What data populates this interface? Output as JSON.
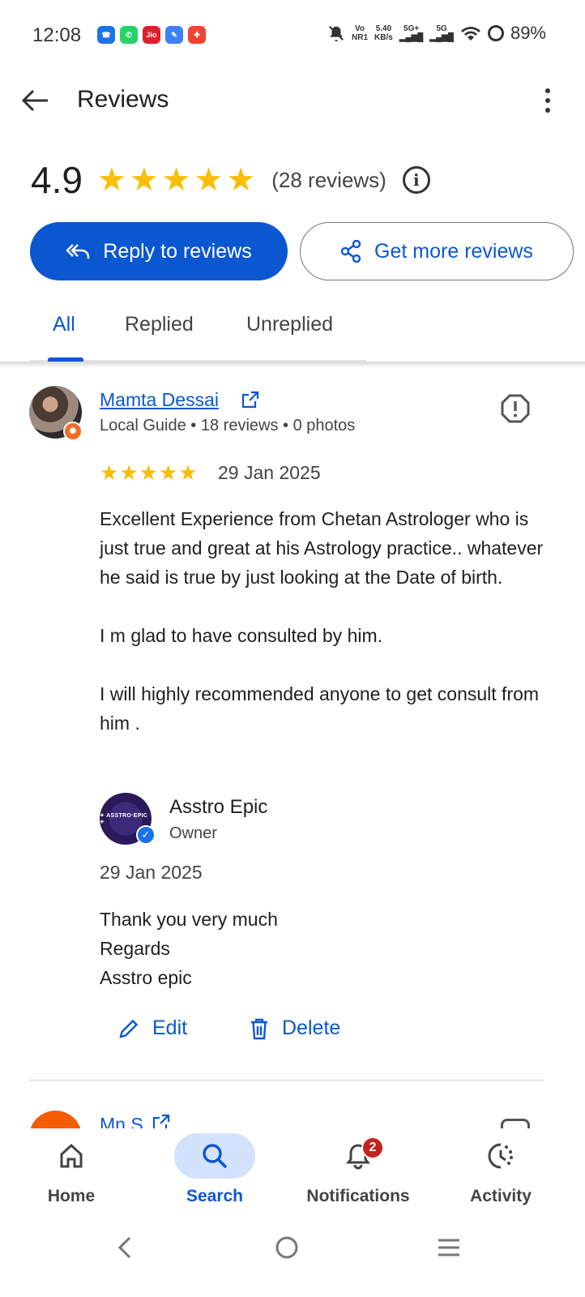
{
  "status_bar": {
    "time": "12:08",
    "network_line1": "Vo",
    "network_line2": "NR1",
    "speed_value": "5.40",
    "speed_unit": "KB/s",
    "sim1": "5G+",
    "sim2": "5G",
    "battery": "89%",
    "app_icons": [
      {
        "name": "phone-app-icon",
        "color": "#1a73e8",
        "label": "☎"
      },
      {
        "name": "whatsapp-icon",
        "color": "#25d366",
        "label": "✆"
      },
      {
        "name": "jio-icon",
        "color": "#e01e2b",
        "label": "Jio"
      },
      {
        "name": "chat-app-icon",
        "color": "#3b82f6",
        "label": "✎"
      },
      {
        "name": "gift-app-icon",
        "color": "#f44336",
        "label": "✚"
      }
    ]
  },
  "app_bar": {
    "title": "Reviews"
  },
  "summary": {
    "rating": "4.9",
    "star_count": 5,
    "review_count": "(28 reviews)"
  },
  "actions": {
    "reply_label": "Reply to reviews",
    "more_reviews_label": "Get more reviews"
  },
  "tabs": [
    {
      "label": "All",
      "active": true
    },
    {
      "label": "Replied",
      "active": false
    },
    {
      "label": "Unreplied",
      "active": false
    }
  ],
  "reviews": [
    {
      "name": "Mamta Dessai",
      "meta": "Local Guide • 18 reviews • 0 photos",
      "stars": 5,
      "date": "29 Jan 2025",
      "text": [
        "Excellent Experience from Chetan Astrologer who is just true and great at his Astrology practice.. whatever he said is true by just looking at the Date of birth.",
        "I m glad to have consulted by him.",
        "I will highly recommended anyone to get consult from him ."
      ],
      "reply": {
        "owner_name": "Asstro Epic",
        "owner_role": "Owner",
        "avatar_text": "✦ ASSTRO·EPIC ✦",
        "date": "29 Jan 2025",
        "lines": [
          "Thank you very much",
          "Regards",
          "Asstro epic"
        ]
      },
      "edit_label": "Edit",
      "delete_label": "Delete"
    },
    {
      "name": "Mn S"
    }
  ],
  "bottom_nav": [
    {
      "label": "Home",
      "active": false
    },
    {
      "label": "Search",
      "active": true
    },
    {
      "label": "Notifications",
      "active": false,
      "badge": "2"
    },
    {
      "label": "Activity",
      "active": false
    }
  ],
  "colors": {
    "accent": "#0b57d0",
    "star": "#fbbc04",
    "badge": "#c5221f"
  }
}
